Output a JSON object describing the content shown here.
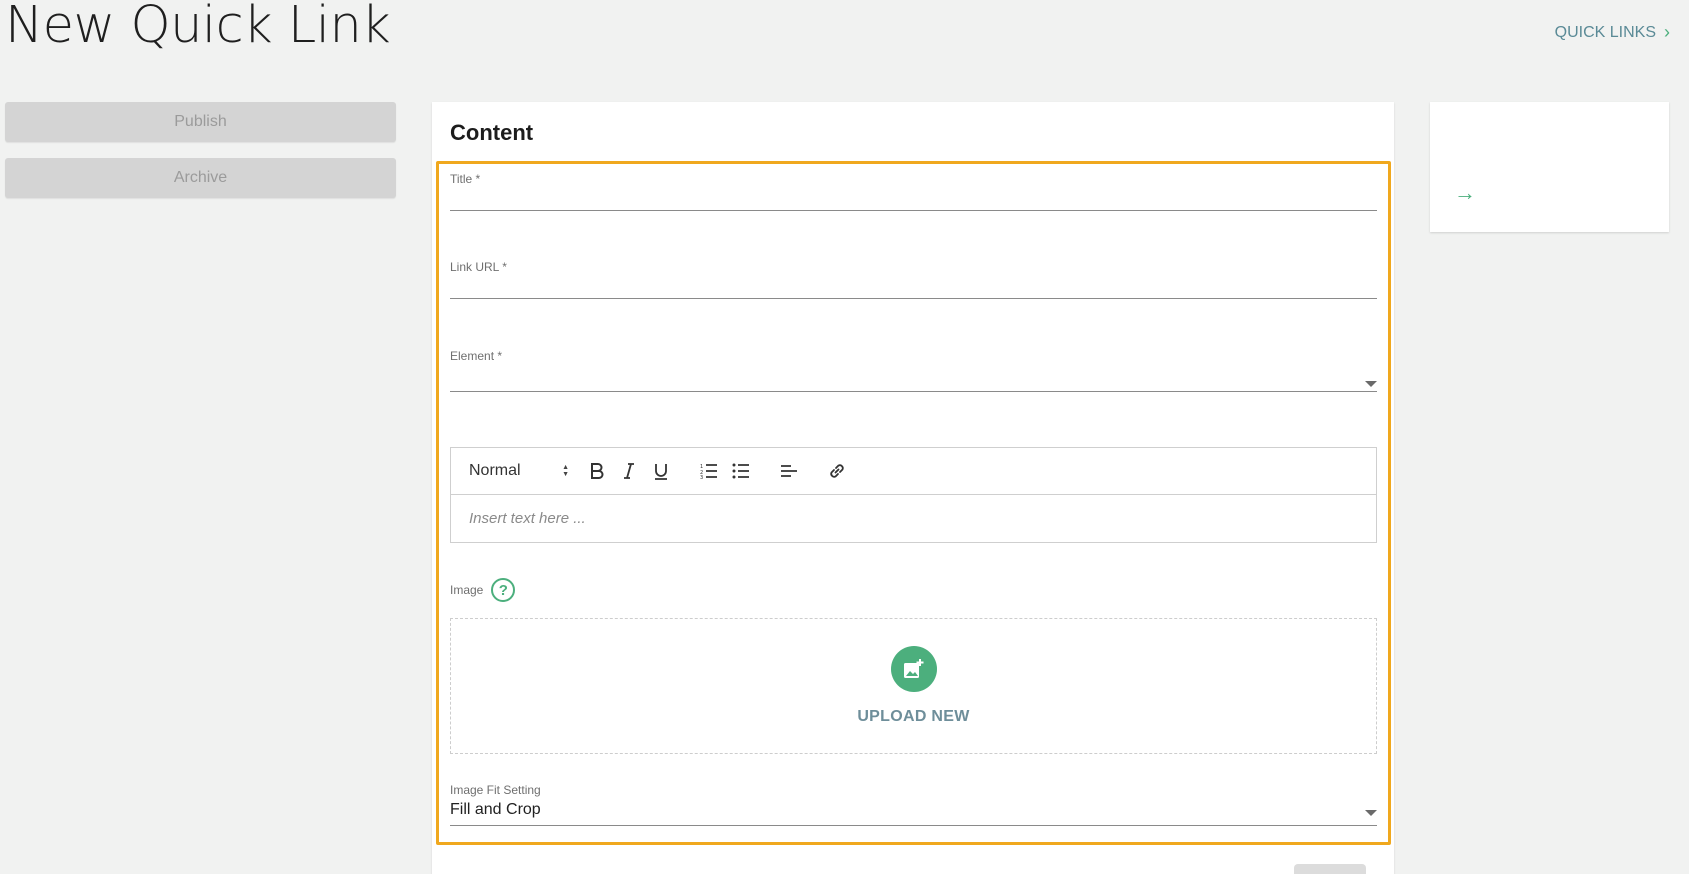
{
  "header": {
    "title": "New Quick Link",
    "breadcrumb_link": "QUICK LINKS",
    "breadcrumb_chevron": "›"
  },
  "sidebar": {
    "publish_label": "Publish",
    "archive_label": "Archive"
  },
  "content": {
    "heading": "Content",
    "title_field": {
      "label": "Title *",
      "value": ""
    },
    "link_url_field": {
      "label": "Link URL *",
      "value": ""
    },
    "element_field": {
      "label": "Element *",
      "value": ""
    },
    "editor": {
      "format_value": "Normal",
      "placeholder": "Insert text here ...",
      "toolbar_icons": [
        "bold-icon",
        "italic-icon",
        "underline-icon",
        "ordered-list-icon",
        "bullet-list-icon",
        "align-left-icon",
        "link-icon"
      ]
    },
    "image": {
      "label": "Image",
      "help_glyph": "?",
      "upload_label": "UPLOAD NEW"
    },
    "image_fit": {
      "label": "Image Fit Setting",
      "value": "Fill and Crop"
    }
  },
  "preview": {
    "arrow_glyph": "→"
  },
  "colors": {
    "accent": "#4caf7d",
    "highlight": "#f0a81e",
    "link": "#5a8a96"
  }
}
